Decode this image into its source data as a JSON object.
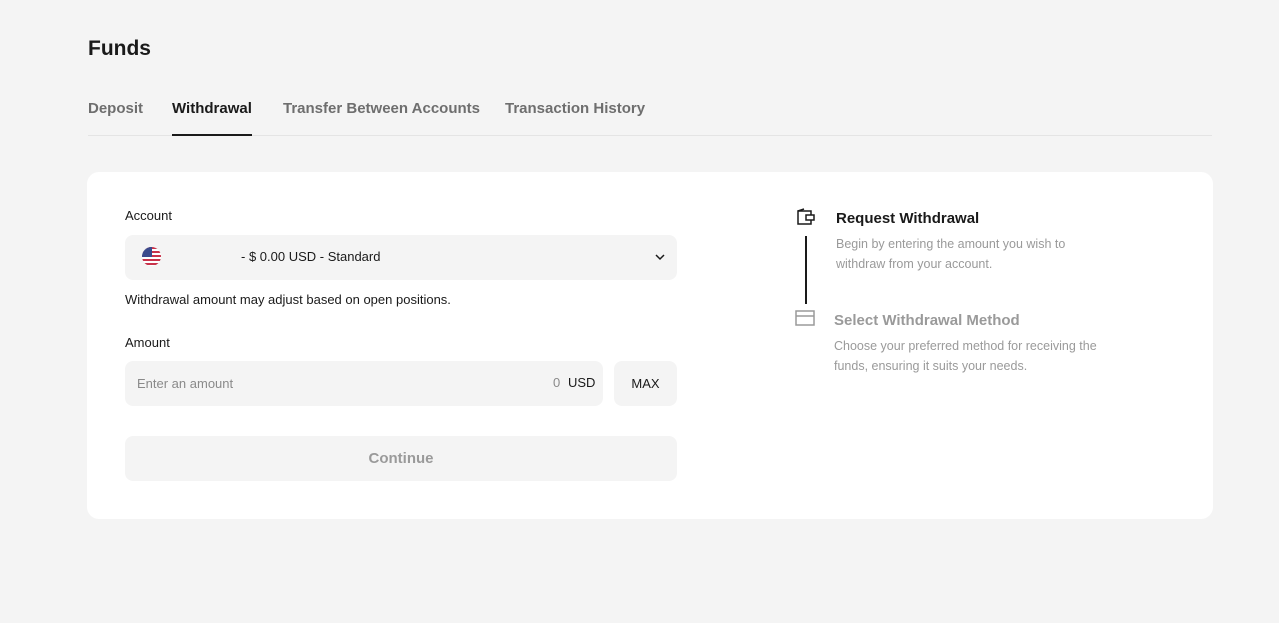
{
  "page": {
    "title": "Funds"
  },
  "tabs": [
    {
      "label": "Deposit",
      "active": false
    },
    {
      "label": "Withdrawal",
      "active": true
    },
    {
      "label": "Transfer Between Accounts",
      "active": false
    },
    {
      "label": "Transaction History",
      "active": false
    }
  ],
  "form": {
    "account_label": "Account",
    "account_selected": "- $ 0.00 USD - Standard",
    "account_flag_icon": "us-flag-icon",
    "note": "Withdrawal amount may adjust based on open positions.",
    "amount_label": "Amount",
    "amount_placeholder": "Enter an amount",
    "amount_value": "0",
    "amount_currency": "USD",
    "max_label": "MAX",
    "continue_label": "Continue"
  },
  "steps": [
    {
      "icon": "wallet-icon",
      "title": "Request Withdrawal",
      "description": "Begin by entering the amount you wish to withdraw from your account.",
      "active": true
    },
    {
      "icon": "card-icon",
      "title": "Select Withdrawal Method",
      "description": "Choose your preferred method for receiving the funds, ensuring it suits your needs.",
      "active": false
    }
  ],
  "colors": {
    "background": "#f4f4f4",
    "card": "#ffffff",
    "text": "#1a1a1a",
    "muted": "#9a9a9a",
    "input": "#f4f4f4"
  }
}
